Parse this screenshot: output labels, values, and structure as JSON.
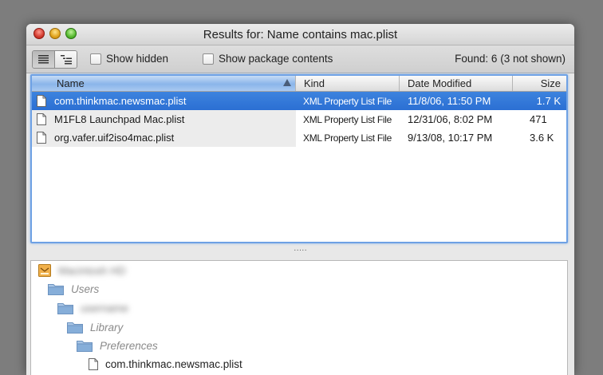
{
  "window": {
    "title": "Results for: Name contains mac.plist"
  },
  "toolbar": {
    "show_hidden_label": "Show hidden",
    "show_package_contents_label": "Show package contents",
    "found_text": "Found: 6 (3 not shown)"
  },
  "table": {
    "columns": {
      "name": "Name",
      "kind": "Kind",
      "date": "Date Modified",
      "size": "Size"
    },
    "rows": [
      {
        "name": "com.thinkmac.newsmac.plist",
        "kind": "XML Property List File",
        "date": "11/8/06, 11:50 PM",
        "size": "1.7 K",
        "selected": true
      },
      {
        "name": "M1FL8 Launchpad Mac.plist",
        "kind": "XML Property List File",
        "date": "12/31/06, 8:02 PM",
        "size": "471",
        "selected": false
      },
      {
        "name": "org.vafer.uif2iso4mac.plist",
        "kind": "XML Property List File",
        "date": "9/13/08, 10:17 PM",
        "size": "3.6 K",
        "selected": false
      }
    ]
  },
  "splitter": "·····",
  "path": {
    "volume": "Macintosh HD",
    "users": "Users",
    "user": "username",
    "library": "Library",
    "preferences": "Preferences",
    "file": "com.thinkmac.newsmac.plist"
  },
  "colors": {
    "selection": "#2f74d6",
    "focus_ring": "#6ea1e4",
    "folder": "#7fa8d4"
  }
}
